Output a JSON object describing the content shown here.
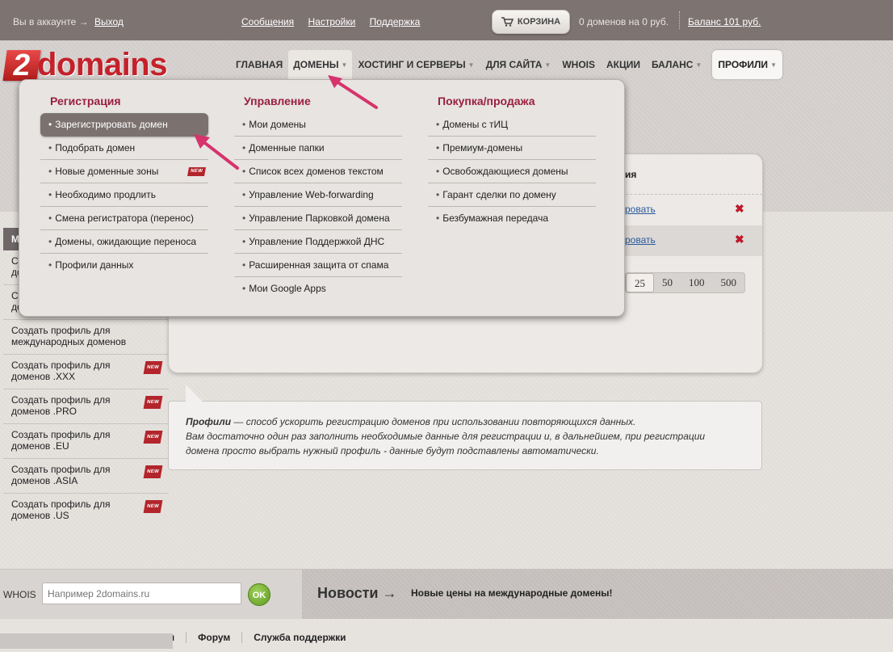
{
  "topbar": {
    "account_text": "Вы в аккаунте →",
    "logout_label": "Выход",
    "links": [
      "Сообщения",
      "Настройки",
      "Поддержка"
    ],
    "cart_label": "КОРЗИНА",
    "cart_info": "0 доменов на 0 руб.",
    "balance": "Баланс 101 руб."
  },
  "logo": {
    "two": "2",
    "word": "domains"
  },
  "nav": {
    "items": [
      "ГЛАВНАЯ",
      "ДОМЕНЫ",
      "ХОСТИНГ И СЕРВЕРЫ",
      "ДЛЯ САЙТА",
      "WHOIS",
      "АКЦИИ",
      "БАЛАНС",
      "ПРОФИЛИ"
    ]
  },
  "dropdown": {
    "col1": {
      "title": "Регистрация",
      "items": [
        "Зарегистрировать домен",
        "Подобрать домен",
        "Новые доменные зоны",
        "Необходимо продлить",
        "Смена регистратора (перенос)",
        "Домены, ожидающие переноса",
        "Профили данных"
      ]
    },
    "col2": {
      "title": "Управление",
      "items": [
        "Мои домены",
        "Доменные папки",
        "Список всех доменов текстом",
        "Управление Web-forwarding",
        "Управление Парковкой домена",
        "Управление Поддержкой ДНС",
        "Расширенная защита от спама",
        "Мои Google Apps"
      ]
    },
    "col3": {
      "title": "Покупка/продажа",
      "items": [
        "Домены с тИЦ",
        "Премиум-домены",
        "Освобождающиеся домены",
        "Гарант сделки по домену",
        "Безбумажная передача"
      ]
    },
    "new_badge": "NEW"
  },
  "sidebar": {
    "head": "М",
    "rows": [
      "Со\nдо",
      "Со\nдо",
      "Создать профиль для\nмеждународных доменов",
      "Создать профиль для\nдоменов .XXX",
      "Создать профиль для\nдоменов .PRO",
      "Создать профиль для\nдоменов .EU",
      "Создать профиль для\nдоменов .ASIA",
      "Создать профиль для\nдоменов .US"
    ]
  },
  "panel": {
    "head_partial": "ия",
    "row_link": "ровать",
    "delete_icon": "✖",
    "pager": [
      "25",
      "50",
      "100",
      "500"
    ]
  },
  "hint": {
    "bold": "Профили",
    "line1": " — способ ускорить регистрацию доменов при использовании повторяющихся данных.",
    "line2": "Вам достаточно один раз заполнить необходимые данные для регистрации и, в дальнейшем, при регистрации",
    "line3": "домена просто выбрать нужный профиль - данные будут подставлены автоматически."
  },
  "footer": {
    "whois_label": "WHOIS",
    "whois_placeholder": "Например 2domains.ru",
    "ok_label": "OK",
    "news_label": "Новости →",
    "news_text": "Новые цены на международные домены!"
  },
  "bottombar": {
    "links": [
      "ты",
      "Форум",
      "Служба поддержки"
    ]
  }
}
